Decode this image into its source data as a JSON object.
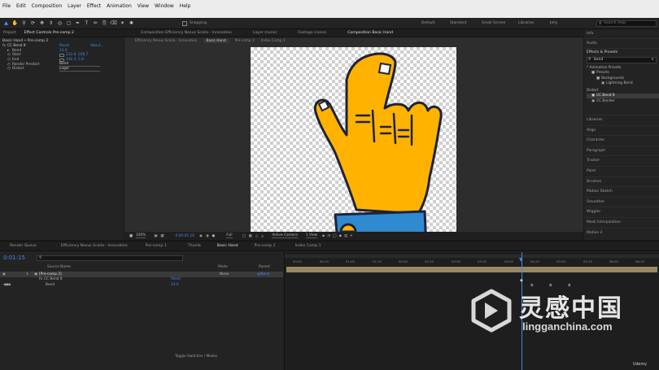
{
  "menu": [
    "File",
    "Edit",
    "Composition",
    "Layer",
    "Effect",
    "Animation",
    "View",
    "Window",
    "Help"
  ],
  "toolbar": {
    "tools": [
      "arrow-icon",
      "hand-icon",
      "zoom-icon",
      "orbit-icon",
      "pan-icon",
      "dolly-icon",
      "pan-behind-icon",
      "rect-mask-icon",
      "pen-icon",
      "type-icon",
      "brush-icon",
      "clone-icon",
      "eraser-icon",
      "roto-icon",
      "puppet-icon"
    ],
    "snapping_label": "Snapping",
    "workspaces": [
      "Default",
      "Standard",
      "Small Screen",
      "Libraries",
      "Jelly"
    ],
    "search_placeholder": "Search Help"
  },
  "left_panel": {
    "tabs": [
      "Project",
      "Effect Controls Pre-comp 2"
    ],
    "header": "Basic Hand • Pre-comp 2",
    "effect": {
      "name": "CC Bend It",
      "reset_label": "Reset",
      "about_label": "About...",
      "params": [
        {
          "name": "Bend",
          "value": "33.0"
        },
        {
          "name": "Start",
          "value": "212.8, 208.7"
        },
        {
          "name": "End",
          "value": "246.4, 5.8"
        },
        {
          "name": "Render Prestart",
          "value": "Bend"
        },
        {
          "name": "Distort",
          "value": "Legal"
        }
      ]
    }
  },
  "comp_panel": {
    "tabs": [
      "Composition Efficiency Nexus Scalia - Innovation",
      "Layer (none)",
      "Footage (none)",
      "Composition Basic Hand"
    ],
    "subtabs": [
      "Efficiency Nexus Scalia - Innovation",
      "Basic Hand",
      "Pre-comp 2",
      "Index Comp 1"
    ],
    "footer": {
      "zoom": "100%",
      "time": "0:00:01:16",
      "resolution": "Full",
      "camera": "Active Camera",
      "views": "1 View"
    }
  },
  "right_panel": {
    "sections_top": [
      "Info",
      "Audio"
    ],
    "effects_title": "Effects & Presets",
    "search_value": "bend",
    "tree": [
      {
        "label": "* Animation Presets",
        "indent": 0
      },
      {
        "label": "Presets",
        "indent": 1
      },
      {
        "label": "Backgrounds",
        "indent": 2
      },
      {
        "label": "Lightning Bend",
        "indent": 3
      },
      {
        "label": "Distort",
        "indent": 0
      },
      {
        "label": "CC Bend It",
        "indent": 1,
        "selected": true
      },
      {
        "label": "CC Bender",
        "indent": 1
      }
    ],
    "sections": [
      "Libraries",
      "Align",
      "Character",
      "Paragraph",
      "Tracker",
      "Paint",
      "Brushes",
      "Motion Sketch",
      "Smoother",
      "Wiggler",
      "Mask Interpolation",
      "Motion 2"
    ]
  },
  "timeline": {
    "tabs": [
      "Render Queue",
      "Efficiency Nexus Scalia - Innovation",
      "Pre-comp 1",
      "Thumb",
      "Basic Hand",
      "Pre-comp 2",
      "Index Comp 1"
    ],
    "timecode": "0:01:15",
    "columns": [
      "Source Name",
      "Mode",
      "Parent"
    ],
    "layers": [
      {
        "num": "1",
        "name": "[Pre-comp 2]",
        "mode": "None",
        "parent": "@None"
      },
      {
        "name": "CC Bend It",
        "value": "Reset"
      },
      {
        "name": "Bend",
        "value": "33.0"
      }
    ],
    "ruler": [
      "00:00",
      "00:15",
      "01:00",
      "01:15",
      "02:00",
      "02:15",
      "03:00",
      "03:15",
      "04:00",
      "04:15",
      "05:00",
      "05:15",
      "06:00",
      "06:15",
      "07:00"
    ],
    "footer_label": "Toggle Switches / Modes"
  },
  "watermark": {
    "chinese": "灵感中国",
    "site": "lingganchina.com",
    "udemy": "Udemy"
  },
  "colors": {
    "accent": "#3f8ae2",
    "hand_fill": "#ffb300",
    "sleeve_fill": "#2f8ad0",
    "outline": "#1e2238",
    "layer_bar": "#bfa57a"
  }
}
